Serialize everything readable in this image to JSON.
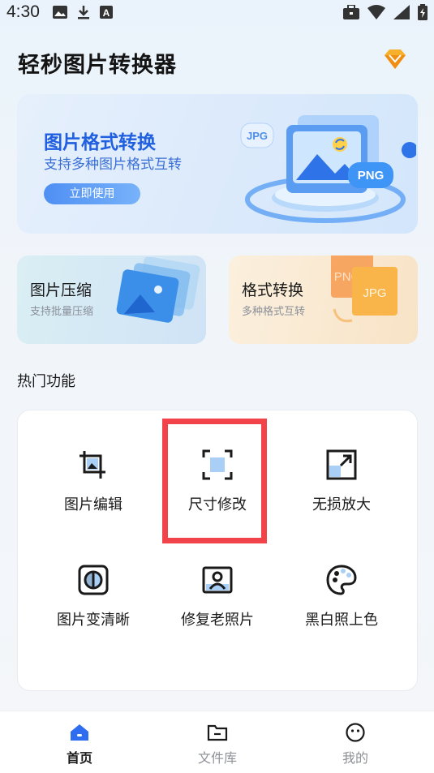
{
  "status_bar": {
    "time": "4:30",
    "left_icons": [
      "gallery-icon",
      "download-icon",
      "accessibility-a-icon"
    ],
    "right_icons": [
      "briefcase-icon",
      "wifi-icon",
      "signal-icon",
      "battery-icon"
    ]
  },
  "header": {
    "title": "轻秒图片转换器",
    "vip_icon": "diamond-vip-icon"
  },
  "hero": {
    "title": "图片格式转换",
    "subtitle": "支持多种图片格式互转",
    "button_label": "立即使用",
    "art_badges": [
      "JPG",
      "PNG"
    ]
  },
  "cards": [
    {
      "id": "compress",
      "title": "图片压缩",
      "subtitle": "支持批量压缩"
    },
    {
      "id": "format",
      "title": "格式转换",
      "subtitle": "多种格式互转",
      "art_badges": [
        "PNG",
        "JPG"
      ]
    }
  ],
  "section": {
    "title": "热门功能"
  },
  "tools": [
    {
      "label": "图片编辑",
      "icon": "crop-icon"
    },
    {
      "label": "尺寸修改",
      "icon": "resize-icon"
    },
    {
      "label": "无损放大",
      "icon": "enlarge-icon"
    },
    {
      "label": "图片变清晰",
      "icon": "sharpen-icon"
    },
    {
      "label": "修复老照片",
      "icon": "portrait-photo-icon"
    },
    {
      "label": "黑白照上色",
      "icon": "palette-icon"
    }
  ],
  "bottom_nav": [
    {
      "label": "首页",
      "icon": "home-icon",
      "active": true
    },
    {
      "label": "文件库",
      "icon": "folder-icon",
      "active": false
    },
    {
      "label": "我的",
      "icon": "face-icon",
      "active": false
    }
  ],
  "colors": {
    "accent": "#2f6df0",
    "highlight": "#f2434a",
    "hero_title": "#1f5fe0"
  }
}
